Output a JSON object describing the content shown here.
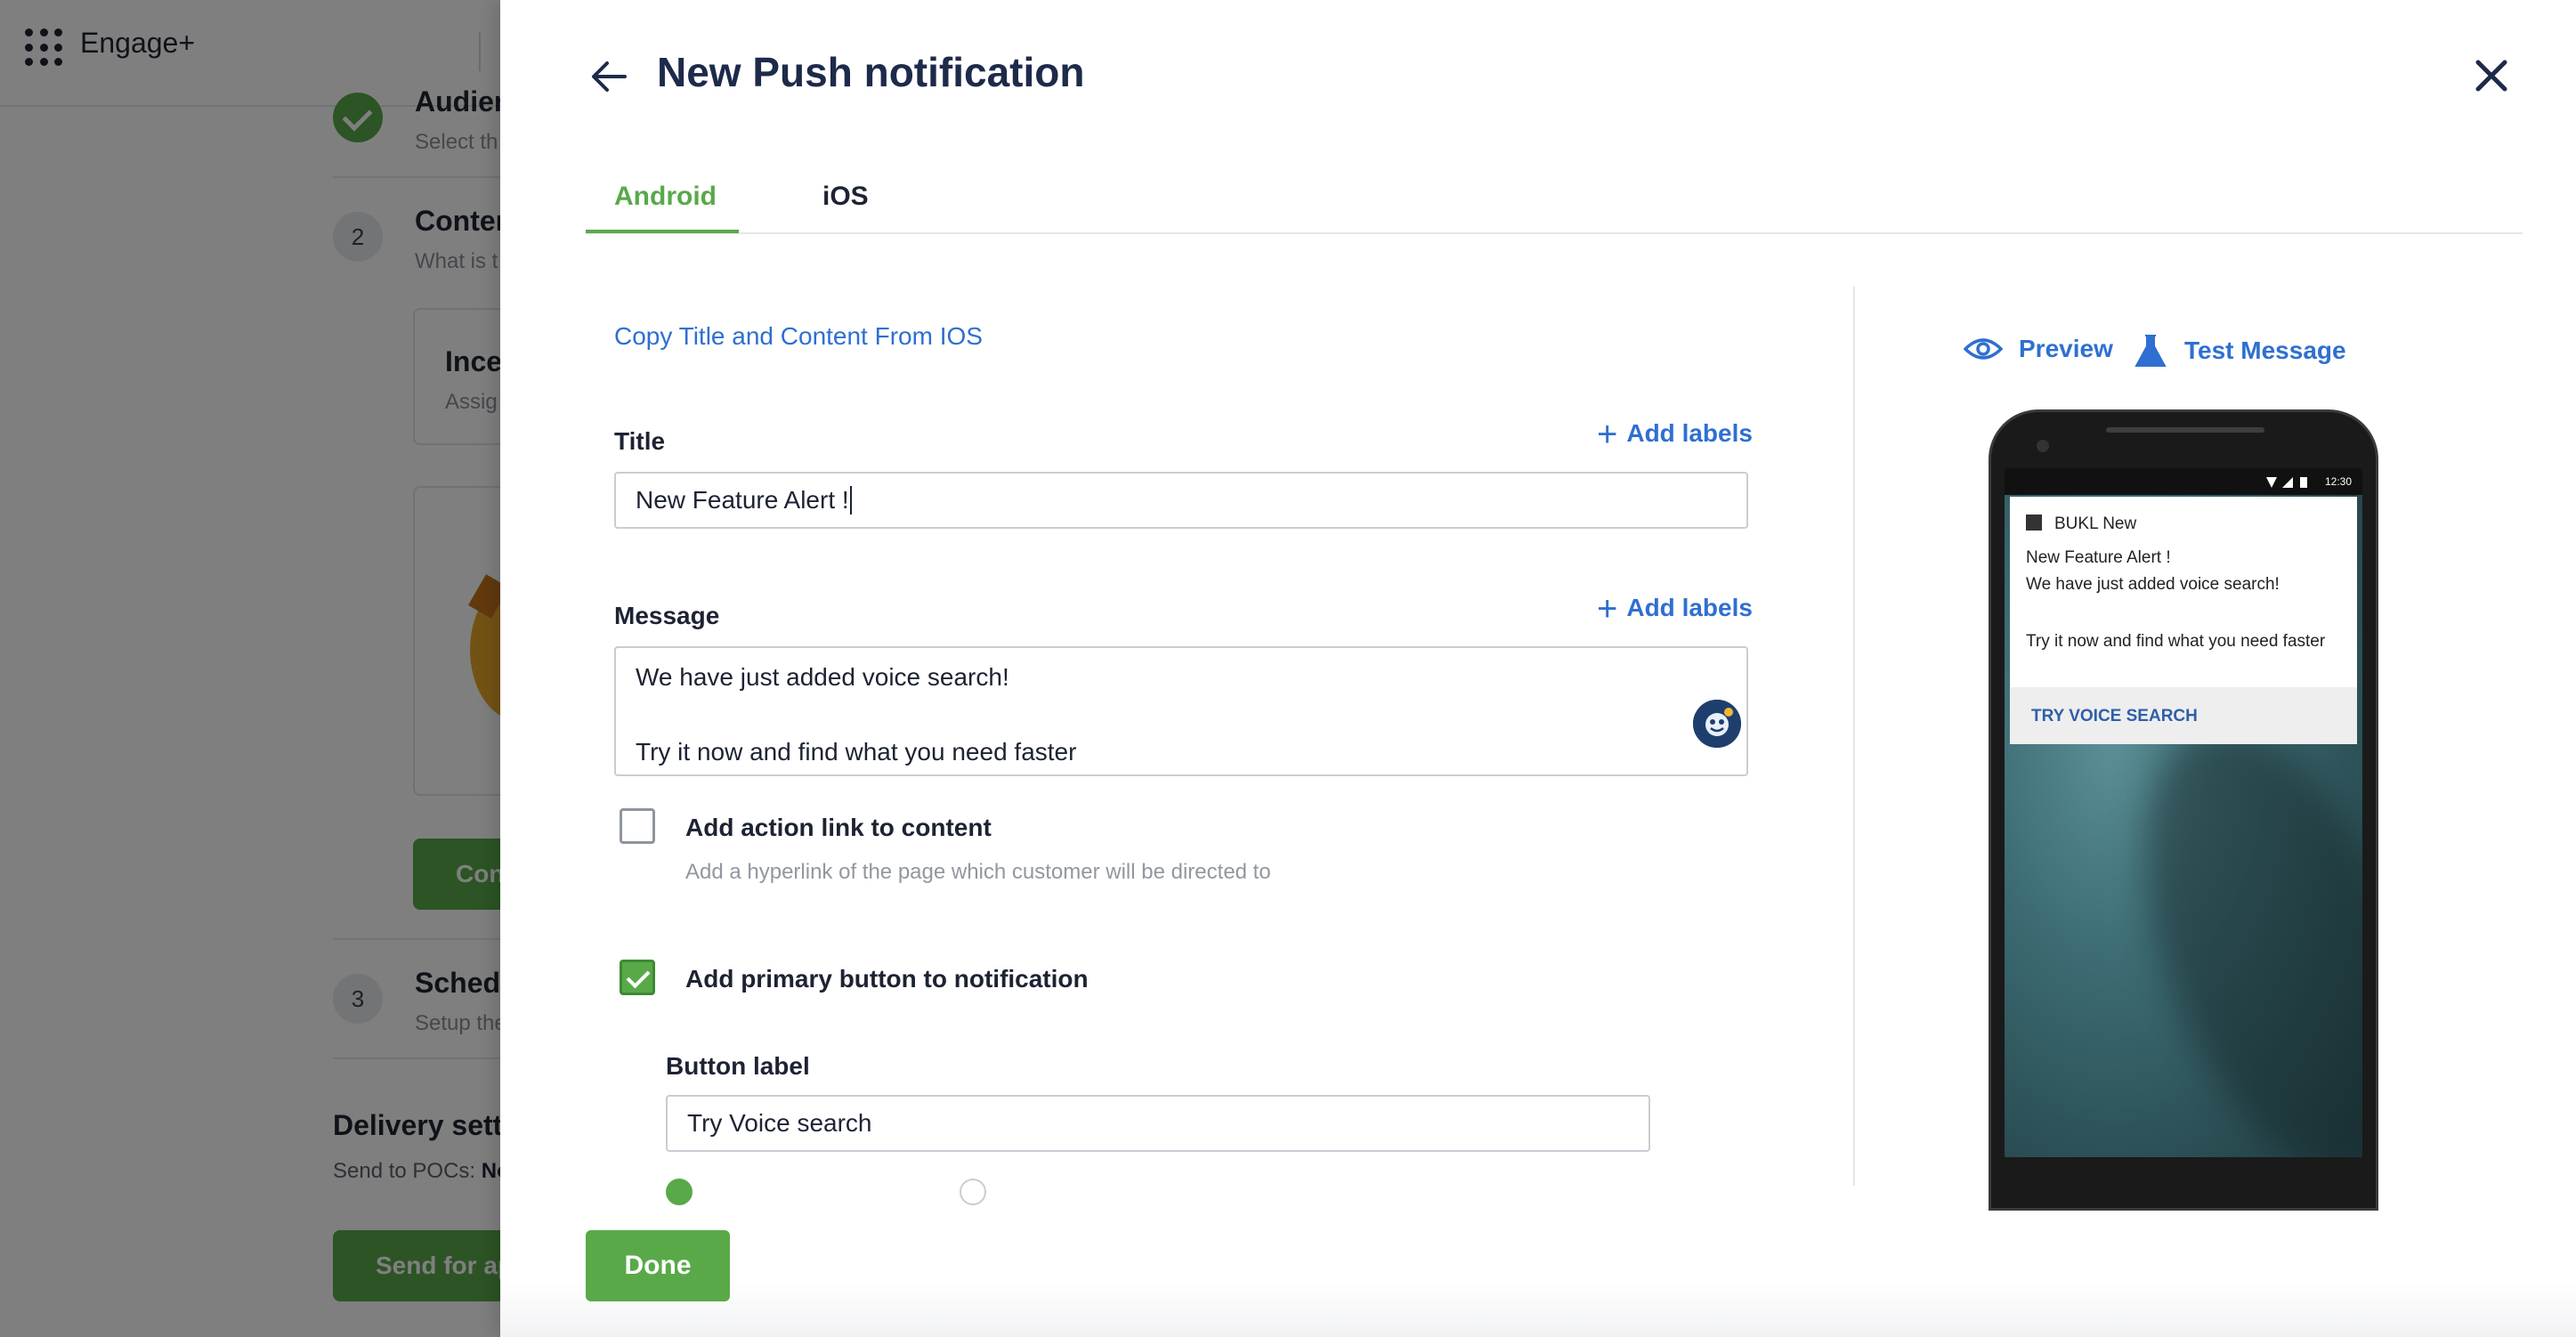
{
  "app": {
    "name": "Engage+"
  },
  "background": {
    "steps": [
      {
        "title": "Audien",
        "sub": "Select th"
      },
      {
        "number": "2",
        "title": "Conten",
        "sub": "What is t"
      },
      {
        "number": "3",
        "title": "Schedu",
        "sub": "Setup the"
      }
    ],
    "card_title": "Ince",
    "card_sub": "Assig",
    "continue_label": "Con",
    "delivery_title": "Delivery setti",
    "send_to": "Send to POCs:",
    "send_to_value": "No",
    "send_button": "Send for ap"
  },
  "drawer": {
    "title": "New Push notification",
    "tabs": [
      {
        "label": "Android",
        "active": true
      },
      {
        "label": "iOS",
        "active": false
      }
    ],
    "copy_link": "Copy Title and Content From IOS",
    "title_field": {
      "label": "Title",
      "value": "New Feature Alert !",
      "add_labels": "Add labels"
    },
    "message_field": {
      "label": "Message",
      "line1": "We have just added voice search!",
      "line2": "Try it now and find what you need faster",
      "add_labels": "Add labels"
    },
    "action_link": {
      "label": "Add action link to content",
      "helper": "Add a hyperlink of the page which customer will be directed to",
      "checked": false
    },
    "primary_button": {
      "label": "Add primary button to notification",
      "checked": true,
      "button_label_title": "Button label",
      "button_label_value": "Try Voice search"
    },
    "preview": {
      "preview_label": "Preview",
      "test_label": "Test Message",
      "status_time": "12:30",
      "notif_app": "BUKL New",
      "notif_title": "New Feature Alert !",
      "notif_line1": "We have just added voice search!",
      "notif_line2": "Try it now and find what you need faster",
      "notif_action": "TRY VOICE SEARCH"
    },
    "done_label": "Done"
  },
  "colors": {
    "accent_green": "#59a949",
    "link_blue": "#2f6fd1",
    "title_navy": "#1d2a4a"
  }
}
